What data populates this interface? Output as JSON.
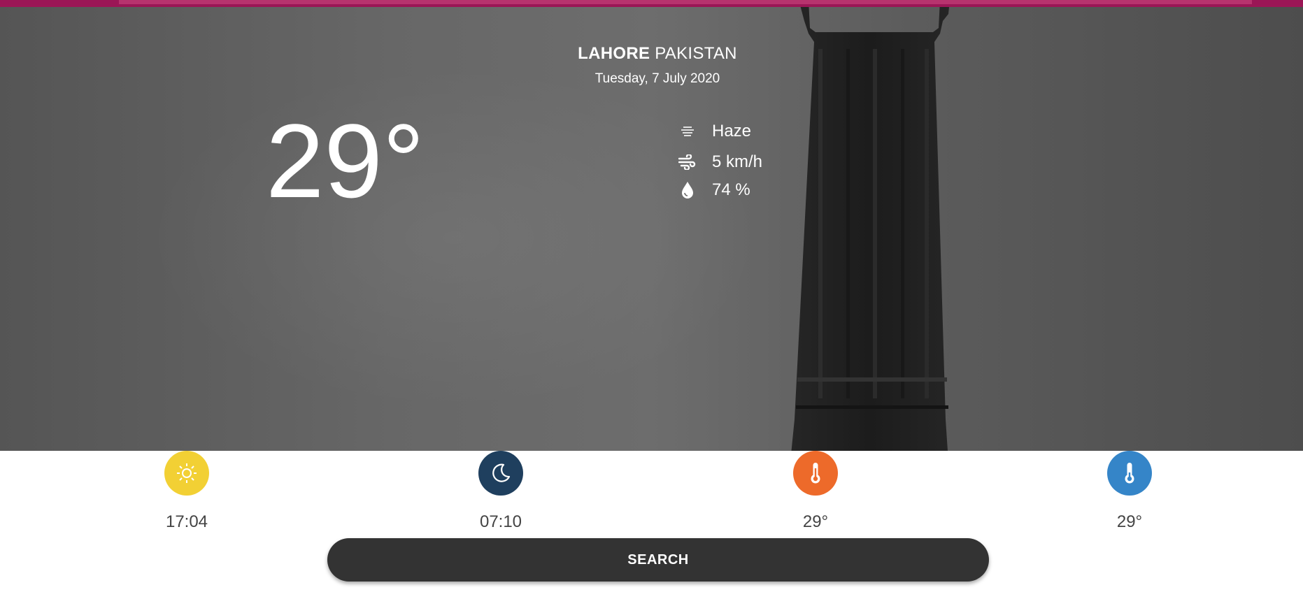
{
  "location": {
    "city": "LAHORE",
    "country": "PAKISTAN"
  },
  "date": "Tuesday, 7 July 2020",
  "current": {
    "temperature": "29°",
    "condition": "Haze",
    "wind": "5 km/h",
    "humidity": "74 %"
  },
  "stats": [
    {
      "icon": "sun-icon",
      "value": "17:04",
      "color": "#f2d034"
    },
    {
      "icon": "moon-icon",
      "value": "07:10",
      "color": "#1f3f5e"
    },
    {
      "icon": "thermometer-hot-icon",
      "value": "29°",
      "color": "#ed6a2a"
    },
    {
      "icon": "thermometer-cold-icon",
      "value": "29°",
      "color": "#3585c8"
    }
  ],
  "search": {
    "label": "SEARCH"
  },
  "colors": {
    "topbar": "#9b1656",
    "button": "#333333",
    "hero_overlay": "#666666"
  }
}
